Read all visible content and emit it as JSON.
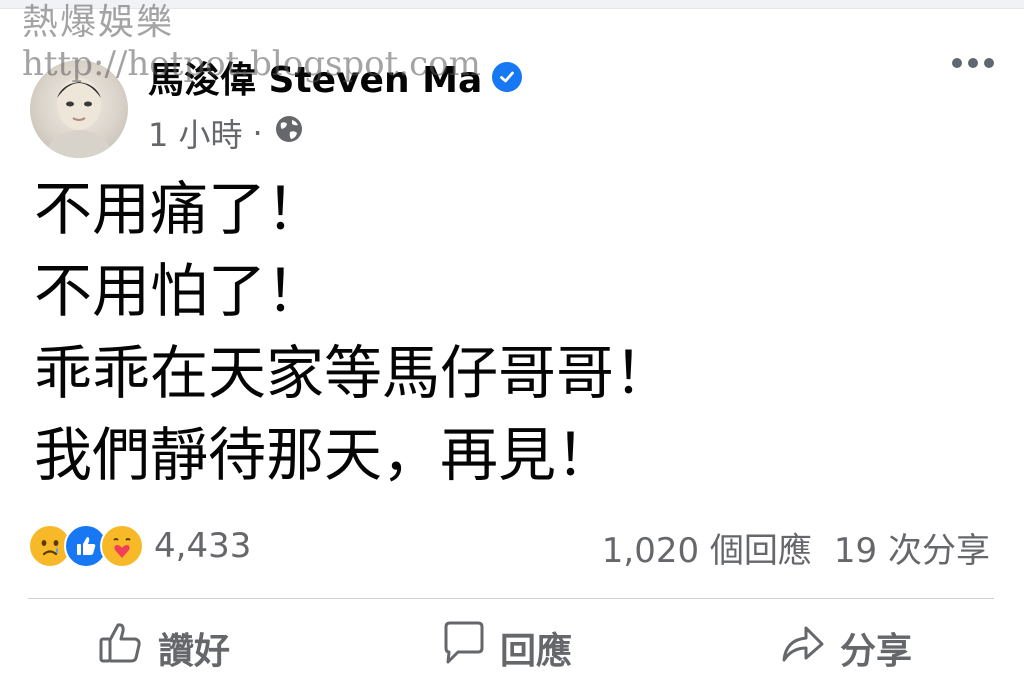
{
  "watermark": {
    "line1": "熱爆娛樂",
    "line2": "http://hotpot.blogspot.com"
  },
  "post": {
    "author": "馬浚偉 Steven Ma",
    "time": "1 小時",
    "separator": "·",
    "body_lines": [
      "不用痛了！",
      "不用怕了！",
      "乖乖在天家等馬仔哥哥！",
      "我們靜待那天，再見！"
    ]
  },
  "engagement": {
    "reaction_count": "4,433",
    "comments": "1,020 個回應",
    "shares": "19 次分享",
    "reaction_icons": [
      "sad-emoji",
      "like",
      "care-emoji"
    ]
  },
  "actions": {
    "like": "讚好",
    "comment": "回應",
    "share": "分享"
  },
  "colors": {
    "accent": "#1877f2",
    "secondary_text": "#65676b",
    "primary_text": "#050505"
  }
}
